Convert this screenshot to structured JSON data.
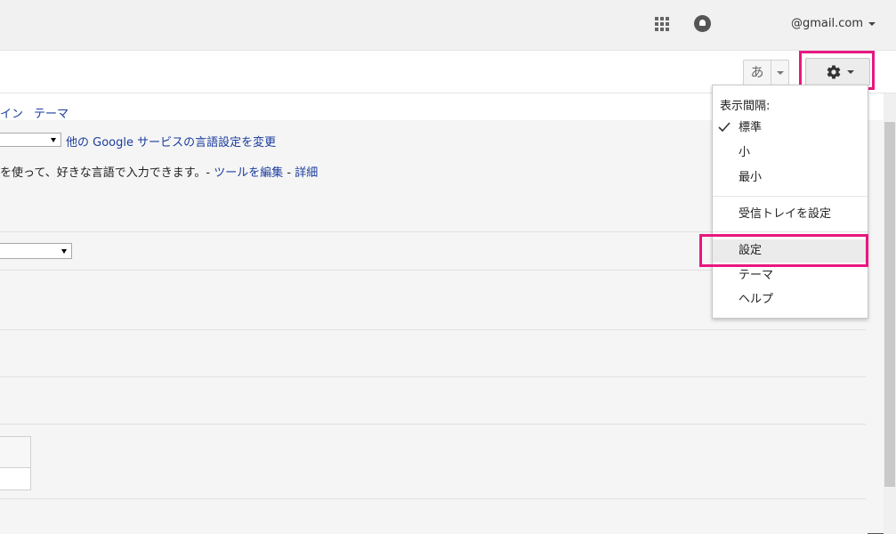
{
  "header": {
    "account": "@gmail.com"
  },
  "toolbar": {
    "ime_label": "あ"
  },
  "tabs": [
    {
      "label": "イン"
    },
    {
      "label": "テーマ"
    }
  ],
  "content": {
    "language_link": "他の Google サービスの言語設定を変更",
    "input_tools_text": "を使って、好きな言語で入力できます。- ",
    "edit_tools_link": "ツールを編集",
    "dash": " - ",
    "details_link": "詳細"
  },
  "menu": {
    "header": "表示間隔:",
    "density": [
      {
        "label": "標準",
        "checked": true
      },
      {
        "label": "小",
        "checked": false
      },
      {
        "label": "最小",
        "checked": false
      }
    ],
    "inbox_settings": "受信トレイを設定",
    "settings": "設定",
    "themes": "テーマ",
    "help": "ヘルプ"
  },
  "colors": {
    "highlight": "#e8177f",
    "link": "#1a3c9e"
  }
}
